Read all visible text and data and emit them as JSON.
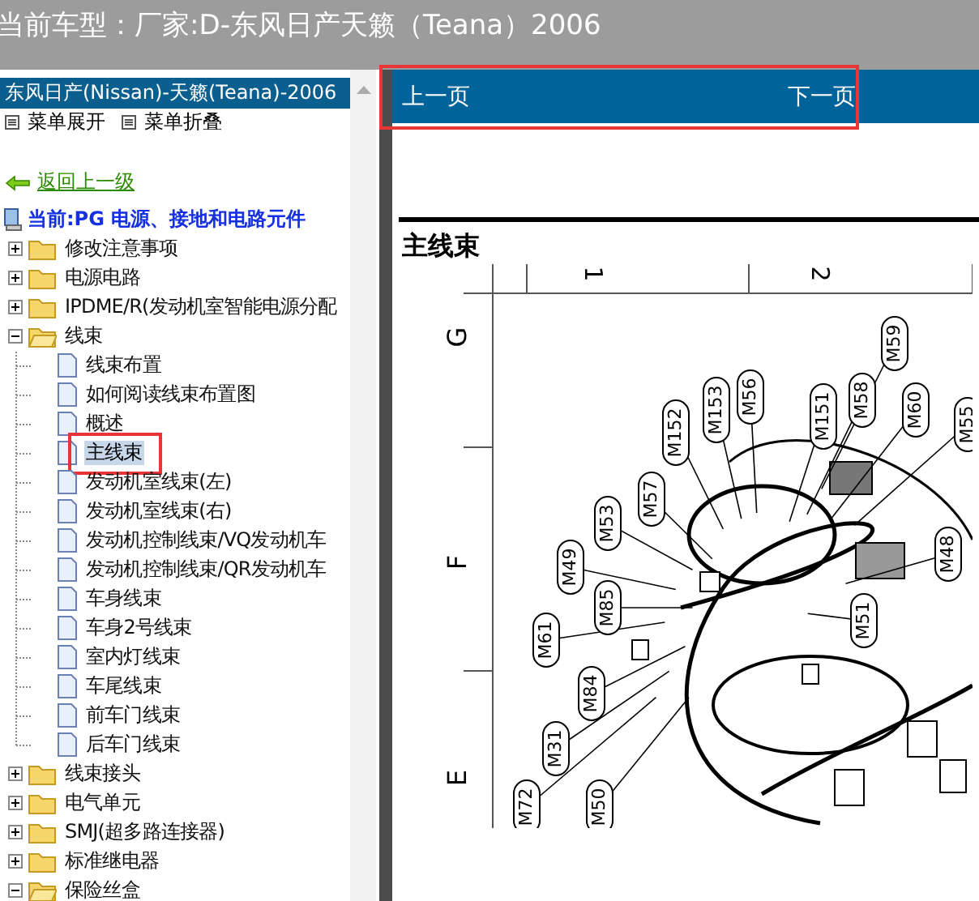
{
  "window": {
    "title": "当前车型：厂家:D-东风日产天籁（Teana）2006"
  },
  "sidebar": {
    "header": {
      "label": "东风日产(Nissan)-天籁(Teana)-2006",
      "selected": true
    },
    "menu_actions": [
      {
        "label": "菜单展开"
      },
      {
        "label": "菜单折叠"
      }
    ],
    "back_link": "返回上一级",
    "current": "当前:PG 电源、接地和电路元件",
    "tree": [
      {
        "kind": "folder",
        "label": "修改注意事项",
        "expanded": false,
        "selected": false
      },
      {
        "kind": "folder",
        "label": "电源电路",
        "expanded": false,
        "selected": false
      },
      {
        "kind": "folder",
        "label": "IPDME/R(发动机室智能电源分配",
        "expanded": false,
        "selected": false
      },
      {
        "kind": "folder",
        "label": "线束",
        "expanded": true,
        "selected": false,
        "children": [
          {
            "kind": "page",
            "label": "线束布置",
            "selected": false
          },
          {
            "kind": "page",
            "label": "如何阅读线束布置图",
            "selected": false
          },
          {
            "kind": "page",
            "label": "概述",
            "selected": false
          },
          {
            "kind": "page",
            "label": "主线束",
            "selected": true
          },
          {
            "kind": "page",
            "label": "发动机室线束(左)",
            "selected": false
          },
          {
            "kind": "page",
            "label": "发动机室线束(右)",
            "selected": false
          },
          {
            "kind": "page",
            "label": "发动机控制线束/VQ发动机车",
            "selected": false
          },
          {
            "kind": "page",
            "label": "发动机控制线束/QR发动机车",
            "selected": false
          },
          {
            "kind": "page",
            "label": "车身线束",
            "selected": false
          },
          {
            "kind": "page",
            "label": "车身2号线束",
            "selected": false
          },
          {
            "kind": "page",
            "label": "室内灯线束",
            "selected": false
          },
          {
            "kind": "page",
            "label": "车尾线束",
            "selected": false
          },
          {
            "kind": "page",
            "label": "前车门线束",
            "selected": false
          },
          {
            "kind": "page",
            "label": "后车门线束",
            "selected": false
          }
        ]
      },
      {
        "kind": "folder",
        "label": "线束接头",
        "expanded": false,
        "selected": false
      },
      {
        "kind": "folder",
        "label": "电气单元",
        "expanded": false,
        "selected": false
      },
      {
        "kind": "folder",
        "label": "SMJ(超多路连接器)",
        "expanded": false,
        "selected": false
      },
      {
        "kind": "folder",
        "label": "标准继电器",
        "expanded": false,
        "selected": false
      },
      {
        "kind": "folder",
        "label": "保险丝盒",
        "expanded": true,
        "selected": false
      }
    ]
  },
  "nav_bar": {
    "prev": "上一页",
    "next": "下一页"
  },
  "document": {
    "title": "主线束",
    "column_marks": [
      "1",
      "2"
    ],
    "row_marks": [
      "G",
      "F",
      "E"
    ],
    "callouts": [
      "M59",
      "M152",
      "M153",
      "M56",
      "M151",
      "M58",
      "M60",
      "M55",
      "M57",
      "M53",
      "M49",
      "M85",
      "M61",
      "M84",
      "M31",
      "M72",
      "M50",
      "M51",
      "M48"
    ]
  }
}
